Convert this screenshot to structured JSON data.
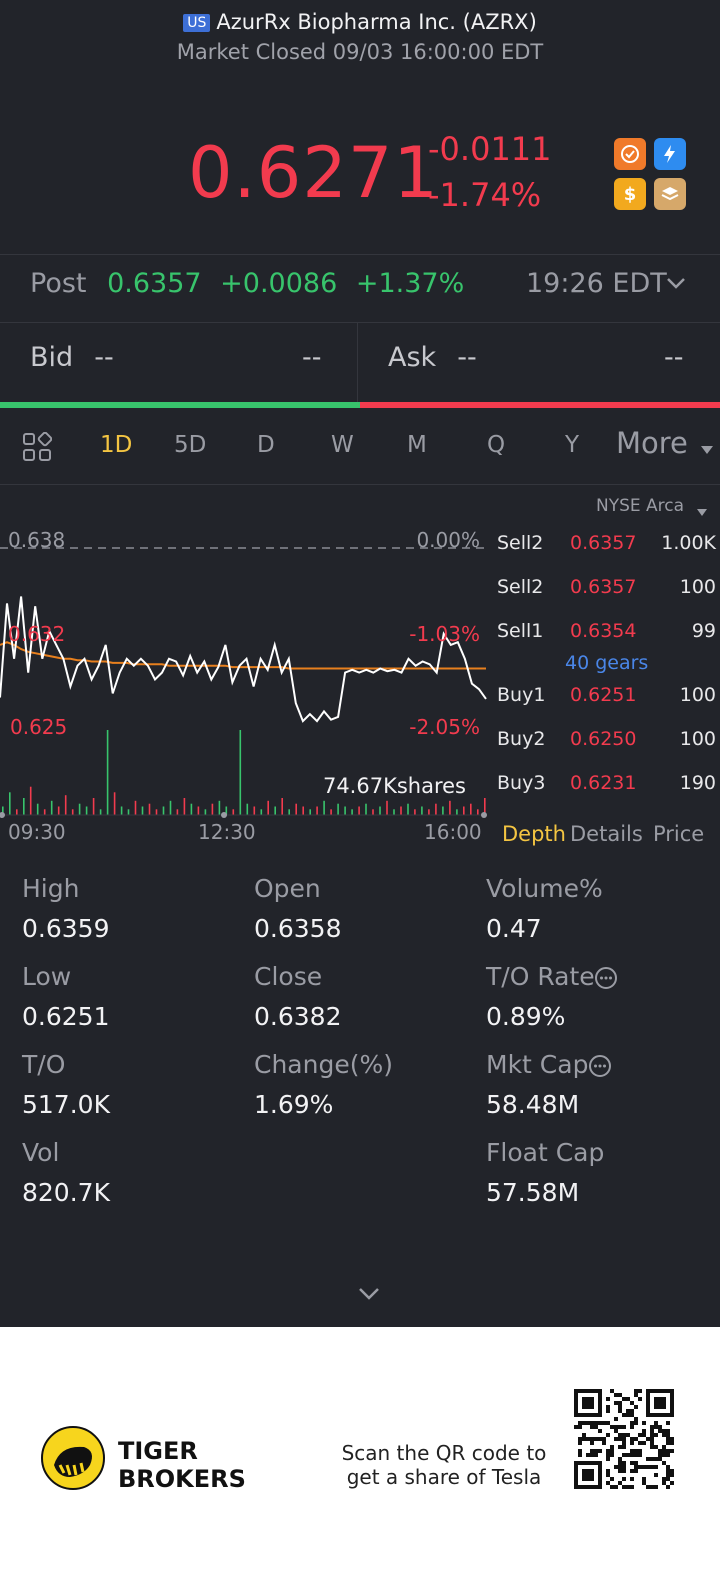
{
  "header": {
    "market_badge": "US",
    "title": "AzurRx Biopharma Inc. (AZRX)",
    "status": "Market Closed 09/03 16:00:00 EDT"
  },
  "quote": {
    "price": "0.6271",
    "change": "-0.0111",
    "change_pct": "-1.74%"
  },
  "post": {
    "label": "Post",
    "price": "0.6357",
    "change": "+0.0086",
    "change_pct": "+1.37%",
    "time": "19:26 EDT"
  },
  "bidask": {
    "bid_label": "Bid",
    "bid_price": "--",
    "bid_size": "--",
    "ask_label": "Ask",
    "ask_price": "--",
    "ask_size": "--",
    "bid_ratio": 0.5
  },
  "tabs": {
    "items": [
      "1D",
      "5D",
      "D",
      "W",
      "M",
      "Q",
      "Y"
    ],
    "active": "1D",
    "more": "More"
  },
  "exchange": "NYSE Arca",
  "chart_data": {
    "type": "line",
    "ylim": [
      0.625,
      0.638
    ],
    "y_labels": {
      "top": "0.638",
      "mid": "0.632",
      "bottom": "0.625"
    },
    "pct_labels": {
      "top": "0.00%",
      "mid": "-1.03%",
      "bottom": "-2.05%"
    },
    "x_labels": [
      "09:30",
      "12:30",
      "16:00"
    ],
    "volume_label": "74.67Kshares",
    "series": [
      {
        "values": [
          0.6272,
          0.634,
          0.63,
          0.6345,
          0.629,
          0.6338,
          0.63,
          0.632,
          0.631,
          0.63,
          0.628,
          0.6295,
          0.63,
          0.6285,
          0.6295,
          0.631,
          0.6275,
          0.629,
          0.63,
          0.6295,
          0.63,
          0.6295,
          0.6285,
          0.629,
          0.63,
          0.6298,
          0.6288,
          0.6302,
          0.629,
          0.6298,
          0.6285,
          0.6294,
          0.631,
          0.6283,
          0.6295,
          0.63,
          0.628,
          0.63,
          0.6292,
          0.631,
          0.629,
          0.63,
          0.6268,
          0.6255,
          0.626,
          0.6255,
          0.6262,
          0.6256,
          0.6258,
          0.629,
          0.6292,
          0.629,
          0.6292,
          0.629,
          0.6293,
          0.6291,
          0.6292,
          0.629,
          0.63,
          0.6295,
          0.6298,
          0.6296,
          0.629,
          0.6318,
          0.631,
          0.6312,
          0.63,
          0.6282,
          0.6278,
          0.6271
        ]
      },
      {
        "values": [
          0.631,
          0.6312,
          0.631,
          0.6307,
          0.6305,
          0.6304,
          0.6303,
          0.6302,
          0.6301,
          0.63,
          0.63,
          0.6299,
          0.6299,
          0.6298,
          0.6298,
          0.6298,
          0.6297,
          0.6297,
          0.6297,
          0.6296,
          0.6296,
          0.6296,
          0.6296,
          0.6296,
          0.6295,
          0.6295,
          0.6295,
          0.6295,
          0.6295,
          0.6295,
          0.6295,
          0.6295,
          0.6295,
          0.6294,
          0.6294,
          0.6294,
          0.6294,
          0.6294,
          0.6294,
          0.6294,
          0.6294,
          0.6293,
          0.6293,
          0.6293,
          0.6293,
          0.6293,
          0.6293,
          0.6293,
          0.6293,
          0.6293,
          0.6293,
          0.6293,
          0.6293,
          0.6293,
          0.6293,
          0.6293,
          0.6293,
          0.6293,
          0.6293,
          0.6293,
          0.6293,
          0.6293,
          0.6293,
          0.6293,
          0.6293,
          0.6293,
          0.6293,
          0.6293,
          0.6293,
          0.6293
        ]
      }
    ],
    "volume": [
      3,
      8,
      2,
      6,
      10,
      4,
      2,
      5,
      3,
      7,
      2,
      4,
      3,
      6,
      2,
      30,
      8,
      3,
      2,
      5,
      3,
      4,
      2,
      3,
      5,
      2,
      6,
      4,
      3,
      2,
      4,
      5,
      3,
      2,
      30,
      4,
      3,
      2,
      5,
      3,
      6,
      2,
      4,
      3,
      2,
      3,
      5,
      2,
      4,
      3,
      2,
      3,
      4,
      2,
      3,
      5,
      2,
      3,
      4,
      2,
      3,
      2,
      4,
      3,
      5,
      2,
      3,
      4,
      2,
      6
    ]
  },
  "orderbook": {
    "rows": [
      {
        "label": "Sell2",
        "price": "0.6357",
        "qty": "1.00K",
        "side": "sell"
      },
      {
        "label": "Sell2",
        "price": "0.6357",
        "qty": "100",
        "side": "sell"
      },
      {
        "label": "Sell1",
        "price": "0.6354",
        "qty": "99",
        "side": "sell"
      },
      {
        "label": "Buy1",
        "price": "0.6251",
        "qty": "100",
        "side": "buy"
      },
      {
        "label": "Buy2",
        "price": "0.6250",
        "qty": "100",
        "side": "buy"
      },
      {
        "label": "Buy3",
        "price": "0.6231",
        "qty": "190",
        "side": "buy"
      }
    ],
    "gears": "40 gears",
    "tabs": [
      "Depth",
      "Details",
      "Price"
    ],
    "active_tab": "Depth"
  },
  "stats": {
    "high_label": "High",
    "high": "0.6359",
    "open_label": "Open",
    "open": "0.6358",
    "volpct_label": "Volume%",
    "volpct": "0.47",
    "low_label": "Low",
    "low": "0.6251",
    "close_label": "Close",
    "close": "0.6382",
    "torate_label": "T/O Rate",
    "torate": "0.89%",
    "to_label": "T/O",
    "to": "517.0K",
    "changepct_label": "Change(%)",
    "changepct": "1.69%",
    "mktcap_label": "Mkt Cap",
    "mktcap": "58.48M",
    "vol_label": "Vol",
    "vol": "820.7K",
    "floatcap_label": "Float Cap",
    "floatcap": "57.58M"
  },
  "footer": {
    "brand_line1": "TIGER",
    "brand_line2": "BROKERS",
    "promo_line1": "Scan the QR code to",
    "promo_line2": "get a share of Tesla"
  },
  "colors": {
    "background": "#22242a",
    "up": "#38c46c",
    "down": "#f23b4e",
    "accent": "#f4c542",
    "gears": "#4a86e8",
    "avg_line": "#e8801e"
  }
}
